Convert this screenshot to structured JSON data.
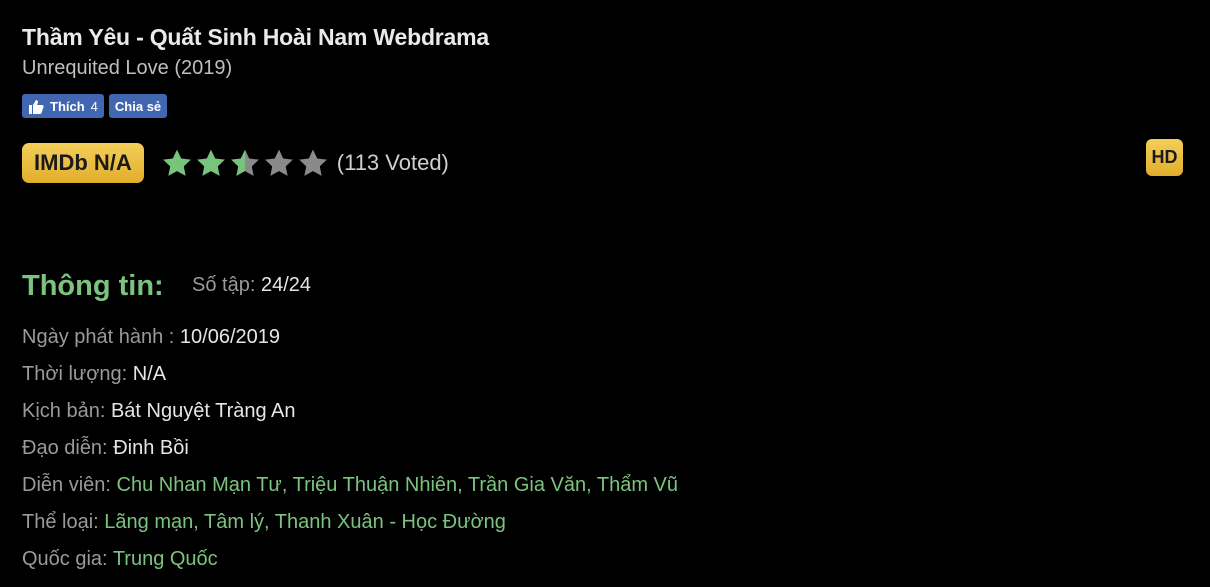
{
  "movie": {
    "title": "Thầm Yêu - Quất Sinh Hoài Nam Webdrama",
    "original_title": "Unrequited Love (2019)"
  },
  "social": {
    "like_label": "Thích",
    "like_count": "4",
    "share_label": "Chia sẻ"
  },
  "rating": {
    "imdb_label": "IMDb N/A",
    "stars": 2.5,
    "max_stars": 5,
    "votes_label": "(113 Voted)"
  },
  "quality_badge": "HD",
  "info": {
    "heading": "Thông tin:",
    "episodes_label": "Số tập:",
    "episodes_value": "24/24",
    "release_label": "Ngày phát hành :",
    "release_value": "10/06/2019",
    "duration_label": "Thời lượng:",
    "duration_value": "N/A",
    "screenplay_label": "Kịch bản:",
    "screenplay_value": "Bát Nguyệt Tràng An",
    "director_label": "Đạo diễn:",
    "director_value": "Đinh Bồi",
    "cast_label": "Diễn viên:",
    "cast": [
      "Chu Nhan Mạn Tư",
      "Triệu Thuận Nhiên",
      "Trần Gia Văn",
      "Thẩm Vũ"
    ],
    "genre_label": "Thể loại:",
    "genres": [
      "Lãng mạn",
      "Tâm lý",
      "Thanh Xuân - Học Đường"
    ],
    "country_label": "Quốc gia:",
    "country_value": "Trung Quốc"
  },
  "colors": {
    "accent_green": "#7bc47f",
    "badge_gold": "#e9bb3c",
    "facebook_blue": "#4267b2",
    "star_filled": "#79c47d",
    "star_empty": "#8a8a8a"
  }
}
